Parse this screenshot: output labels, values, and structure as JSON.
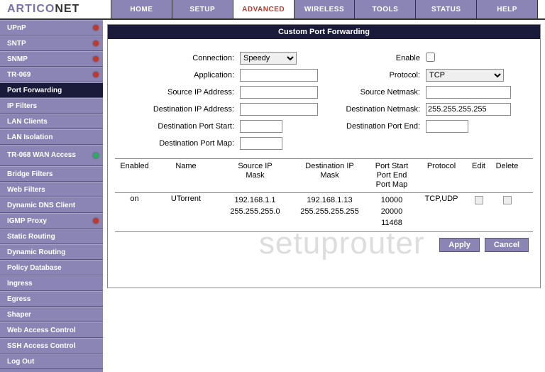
{
  "logo": {
    "part1": "ARTICO",
    "part2": "NET"
  },
  "topnav": [
    "HOME",
    "SETUP",
    "ADVANCED",
    "WIRELESS",
    "TOOLS",
    "STATUS",
    "HELP"
  ],
  "topnav_active": 2,
  "sidebar": [
    {
      "label": "UPnP",
      "dot": "red"
    },
    {
      "label": "SNTP",
      "dot": "red"
    },
    {
      "label": "SNMP",
      "dot": "red"
    },
    {
      "label": "TR-069",
      "dot": "red"
    },
    {
      "label": "Port Forwarding",
      "active": true
    },
    {
      "label": "IP Filters"
    },
    {
      "label": "LAN Clients"
    },
    {
      "label": "LAN Isolation"
    },
    {
      "label": "TR-068 WAN Access",
      "dot": "green",
      "tall": true
    },
    {
      "label": "Bridge Filters"
    },
    {
      "label": "Web Filters"
    },
    {
      "label": "Dynamic DNS Client"
    },
    {
      "label": "IGMP Proxy",
      "dot": "red"
    },
    {
      "label": "Static Routing"
    },
    {
      "label": "Dynamic Routing"
    },
    {
      "label": "Policy Database"
    },
    {
      "label": "Ingress"
    },
    {
      "label": "Egress"
    },
    {
      "label": "Shaper"
    },
    {
      "label": "Web Access Control"
    },
    {
      "label": "SSH Access Control"
    },
    {
      "label": "Log Out"
    }
  ],
  "panel": {
    "title": "Custom Port Forwarding"
  },
  "form": {
    "connection_label": "Connection:",
    "connection_value": "Speedy",
    "enable_label": "Enable",
    "application_label": "Application:",
    "application_value": "",
    "protocol_label": "Protocol:",
    "protocol_value": "TCP",
    "src_ip_label": "Source IP Address:",
    "src_ip_value": "",
    "src_mask_label": "Source Netmask:",
    "src_mask_value": "",
    "dst_ip_label": "Destination IP Address:",
    "dst_ip_value": "",
    "dst_mask_label": "Destination Netmask:",
    "dst_mask_value": "255.255.255.255",
    "port_start_label": "Destination Port Start:",
    "port_start_value": "",
    "port_end_label": "Destination Port End:",
    "port_end_value": "",
    "port_map_label": "Destination Port Map:",
    "port_map_value": ""
  },
  "table": {
    "headers": {
      "enabled": "Enabled",
      "name": "Name",
      "srcmask": "Source IP Mask",
      "dstmask": "Destination IP Mask",
      "ports": "Port Start Port End Port Map",
      "protocol": "Protocol",
      "edit": "Edit",
      "delete": "Delete"
    },
    "row": {
      "enabled": "on",
      "name": "UTorrent",
      "src_ip": "192.168.1.1",
      "src_mask": "255.255.255.0",
      "dst_ip": "192.168.1.13",
      "dst_mask": "255.255.255.255",
      "port_start": "10000",
      "port_end": "20000",
      "port_map": "11468",
      "protocol": "TCP,UDP"
    }
  },
  "buttons": {
    "apply": "Apply",
    "cancel": "Cancel"
  },
  "watermark": "setuprouter"
}
